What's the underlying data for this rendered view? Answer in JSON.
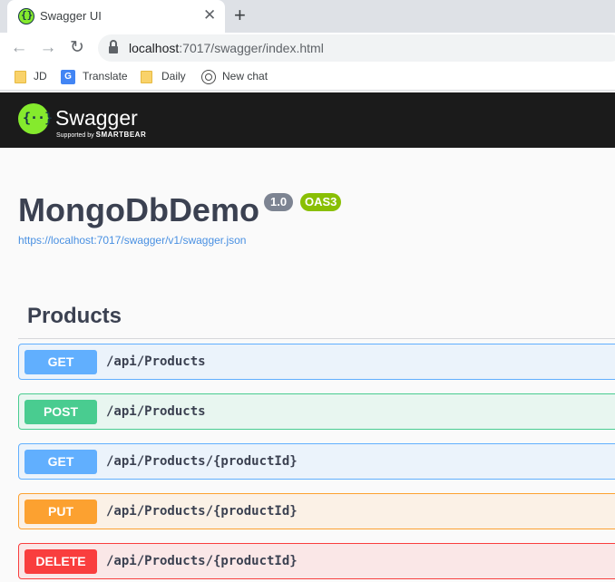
{
  "browser": {
    "tab_title": "Swagger UI",
    "tab_close": "✕",
    "new_tab": "+",
    "url_host": "localhost",
    "url_path": ":7017/swagger/index.html",
    "bookmarks": [
      {
        "label": "JD",
        "icon": "folder-icon"
      },
      {
        "label": "Translate",
        "icon": "translate-icon"
      },
      {
        "label": "Daily",
        "icon": "folder-icon"
      },
      {
        "label": "New chat",
        "icon": "chat-icon"
      }
    ]
  },
  "topbar": {
    "logo_text": "Swagger",
    "logo_subtitle_prefix": "Supported by",
    "logo_subtitle_brand": "SMARTBEAR",
    "colors": {
      "background": "#1b1b1b",
      "logo": "#85ea2d"
    }
  },
  "info": {
    "title": "MongoDbDemo",
    "version": "1.0",
    "oas": "OAS3",
    "spec_url": "https://localhost:7017/swagger/v1/swagger.json"
  },
  "tag": {
    "name": "Products",
    "operations": [
      {
        "method": "GET",
        "path": "/api/Products",
        "color": "#61affe"
      },
      {
        "method": "POST",
        "path": "/api/Products",
        "color": "#49cc90"
      },
      {
        "method": "GET",
        "path": "/api/Products/{productId}",
        "color": "#61affe"
      },
      {
        "method": "PUT",
        "path": "/api/Products/{productId}",
        "color": "#fca130"
      },
      {
        "method": "DELETE",
        "path": "/api/Products/{productId}",
        "color": "#f93e3e"
      }
    ]
  }
}
